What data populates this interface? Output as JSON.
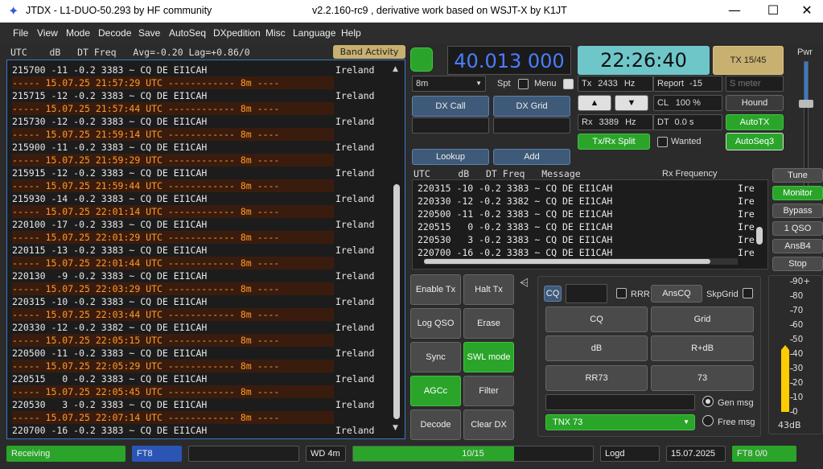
{
  "window": {
    "title": "JTDX - L1-DUO-50.293  by HF community",
    "version_text": "v2.2.160-rc9 , derivative work based on WSJT-X by K1JT"
  },
  "menu": [
    "File",
    "View",
    "Mode",
    "Decode",
    "Save",
    "AutoSeq",
    "DXpedition",
    "Misc",
    "Language",
    "Help"
  ],
  "band_activity": {
    "header": "UTC    dB   DT Freq   Avg=-0.20 Lag=+0.86/0",
    "button": "Band Activity",
    "lines": [
      {
        "t": "215700 -11 -0.2 3383 ~ CQ DE EI1CAH",
        "c": "Ireland",
        "sep": false
      },
      {
        "t": "----- 15.07.25 21:57:29 UTC ------------ 8m ----",
        "c": "",
        "sep": true
      },
      {
        "t": "215715 -12 -0.2 3383 ~ CQ DE EI1CAH",
        "c": "Ireland",
        "sep": false
      },
      {
        "t": "----- 15.07.25 21:57:44 UTC ------------ 8m ----",
        "c": "",
        "sep": true
      },
      {
        "t": "215730 -12 -0.2 3383 ~ CQ DE EI1CAH",
        "c": "Ireland",
        "sep": false
      },
      {
        "t": "----- 15.07.25 21:59:14 UTC ------------ 8m ----",
        "c": "",
        "sep": true
      },
      {
        "t": "215900 -11 -0.2 3383 ~ CQ DE EI1CAH",
        "c": "Ireland",
        "sep": false
      },
      {
        "t": "----- 15.07.25 21:59:29 UTC ------------ 8m ----",
        "c": "",
        "sep": true
      },
      {
        "t": "215915 -12 -0.2 3383 ~ CQ DE EI1CAH",
        "c": "Ireland",
        "sep": false
      },
      {
        "t": "----- 15.07.25 21:59:44 UTC ------------ 8m ----",
        "c": "",
        "sep": true
      },
      {
        "t": "215930 -14 -0.2 3383 ~ CQ DE EI1CAH",
        "c": "Ireland",
        "sep": false
      },
      {
        "t": "----- 15.07.25 22:01:14 UTC ------------ 8m ----",
        "c": "",
        "sep": true
      },
      {
        "t": "220100 -17 -0.2 3383 ~ CQ DE EI1CAH",
        "c": "Ireland",
        "sep": false
      },
      {
        "t": "----- 15.07.25 22:01:29 UTC ------------ 8m ----",
        "c": "",
        "sep": true
      },
      {
        "t": "220115 -13 -0.2 3383 ~ CQ DE EI1CAH",
        "c": "Ireland",
        "sep": false
      },
      {
        "t": "----- 15.07.25 22:01:44 UTC ------------ 8m ----",
        "c": "",
        "sep": true
      },
      {
        "t": "220130  -9 -0.2 3383 ~ CQ DE EI1CAH",
        "c": "Ireland",
        "sep": false
      },
      {
        "t": "----- 15.07.25 22:03:29 UTC ------------ 8m ----",
        "c": "",
        "sep": true
      },
      {
        "t": "220315 -10 -0.2 3383 ~ CQ DE EI1CAH",
        "c": "Ireland",
        "sep": false
      },
      {
        "t": "----- 15.07.25 22:03:44 UTC ------------ 8m ----",
        "c": "",
        "sep": true
      },
      {
        "t": "220330 -12 -0.2 3382 ~ CQ DE EI1CAH",
        "c": "Ireland",
        "sep": false
      },
      {
        "t": "----- 15.07.25 22:05:15 UTC ------------ 8m ----",
        "c": "",
        "sep": true
      },
      {
        "t": "220500 -11 -0.2 3383 ~ CQ DE EI1CAH",
        "c": "Ireland",
        "sep": false
      },
      {
        "t": "----- 15.07.25 22:05:29 UTC ------------ 8m ----",
        "c": "",
        "sep": true
      },
      {
        "t": "220515   0 -0.2 3383 ~ CQ DE EI1CAH",
        "c": "Ireland",
        "sep": false
      },
      {
        "t": "----- 15.07.25 22:05:45 UTC ------------ 8m ----",
        "c": "",
        "sep": true
      },
      {
        "t": "220530   3 -0.2 3383 ~ CQ DE EI1CAH",
        "c": "Ireland",
        "sep": false
      },
      {
        "t": "----- 15.07.25 22:07:14 UTC ------------ 8m ----",
        "c": "",
        "sep": true
      },
      {
        "t": "220700 -16 -0.2 3383 ~ CQ DE EI1CAH",
        "c": "Ireland",
        "sep": false
      }
    ]
  },
  "controls": {
    "frequency": "40.013 000",
    "clock": "22:26:40",
    "tx_period": "TX 15/45",
    "band": "8m",
    "spt_label": "Spt",
    "menu_label": "Menu",
    "tx_freq_label": "Tx",
    "tx_freq": "2433",
    "rx_freq_label": "Rx",
    "rx_freq": "3389",
    "hz": "Hz",
    "report_label": "Report",
    "report": "-15",
    "smeter_placeholder": "S meter",
    "cl_label": "CL",
    "cl_value": "100 %",
    "dt_label": "DT",
    "dt_value": "0.0 s",
    "dx_call": "DX Call",
    "dx_grid": "DX Grid",
    "lookup": "Lookup",
    "add": "Add",
    "txrx_split": "Tx/Rx Split",
    "wanted": "Wanted",
    "hound": "Hound",
    "autotx": "AutoTX",
    "autoseq3": "AutoSeq3",
    "pwr": "Pwr",
    "up_arrow": "▲",
    "down_arrow": "▼"
  },
  "rx_frequency": {
    "header": "UTC     dB   DT Freq   Message",
    "header_right": "Rx Frequency",
    "lines": [
      {
        "t": "220315 -10 -0.2 3383 ~ CQ DE EI1CAH",
        "c": "Ire"
      },
      {
        "t": "220330 -12 -0.2 3382 ~ CQ DE EI1CAH",
        "c": "Ire"
      },
      {
        "t": "220500 -11 -0.2 3383 ~ CQ DE EI1CAH",
        "c": "Ire"
      },
      {
        "t": "220515   0 -0.2 3383 ~ CQ DE EI1CAH",
        "c": "Ire"
      },
      {
        "t": "220530   3 -0.2 3383 ~ CQ DE EI1CAH",
        "c": "Ire"
      },
      {
        "t": "220700 -16 -0.2 3383 ~ CQ DE EI1CAH",
        "c": "Ire"
      }
    ]
  },
  "side_buttons": [
    "Tune",
    "Monitor",
    "Bypass",
    "1 QSO",
    "AnsB4",
    "Stop"
  ],
  "action_buttons": {
    "enable_tx": "Enable Tx",
    "halt_tx": "Halt Tx",
    "log_qso": "Log QSO",
    "erase": "Erase",
    "sync": "Sync",
    "swl_mode": "SWL mode",
    "agcc": "AGCc",
    "filter": "Filter",
    "decode": "Decode",
    "clear_dx": "Clear DX"
  },
  "tx_messages": {
    "cq_label": "CQ",
    "rrr": "RRR",
    "anscq": "AnsCQ",
    "skpgrid": "SkpGrid",
    "cq": "CQ",
    "grid": "Grid",
    "db": "dB",
    "r_db": "R+dB",
    "rr73": "RR73",
    "n73": "73",
    "tnx73": "TNX 73",
    "gen_msg": "Gen msg",
    "free_msg": "Free msg"
  },
  "meter": {
    "ticks": [
      "90+",
      "80",
      "70",
      "60",
      "50",
      "40",
      "30",
      "20",
      "10",
      "0"
    ],
    "level_db": 43,
    "readout": "43dB"
  },
  "status": {
    "receiving": "Receiving",
    "mode": "FT8",
    "wd": "WD 4m",
    "progress": "10/15",
    "progress_fraction": 0.67,
    "logd": "Logd",
    "date": "15.07.2025",
    "ft8_count": "FT8  0/0"
  }
}
